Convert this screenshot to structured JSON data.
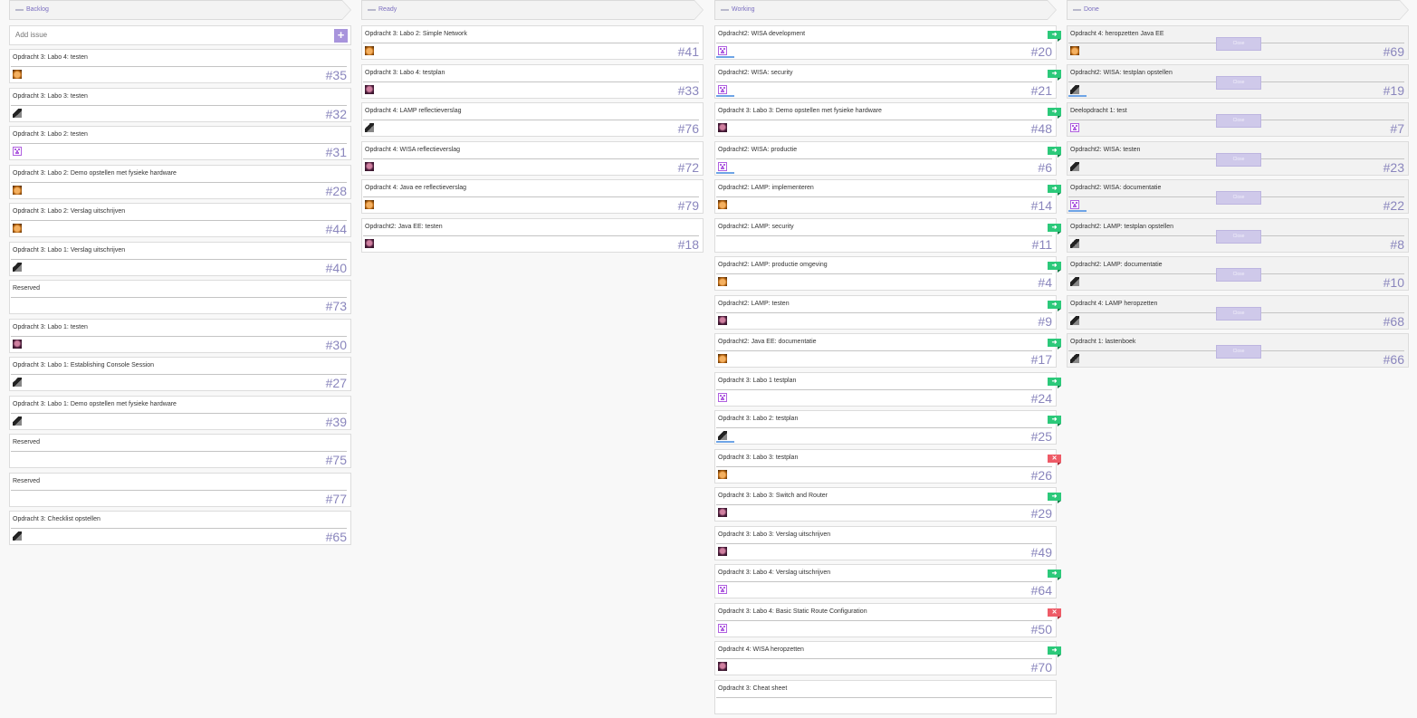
{
  "columns": [
    {
      "title": "Backlog",
      "add_placeholder": "Add issue",
      "add_label": "+",
      "cards": [
        {
          "title": "Opdracht 3: Labo 4: testen",
          "number": "#35",
          "avatar": "orange"
        },
        {
          "title": "Opdracht 3: Labo 3: testen",
          "number": "#32",
          "avatar": "dark"
        },
        {
          "title": "Opdracht 3: Labo 2: testen",
          "number": "#31",
          "avatar": "pixel"
        },
        {
          "title": "Opdracht 3: Labo 2: Demo opstellen met fysieke hardware",
          "number": "#28",
          "avatar": "orange"
        },
        {
          "title": "Opdracht 3: Labo 2: Verslag uitschrijven",
          "number": "#44",
          "avatar": "orange"
        },
        {
          "title": "Opdracht 3: Labo 1: Verslag uitschrijven",
          "number": "#40",
          "avatar": "dark"
        },
        {
          "title": "Reserved",
          "number": "#73",
          "avatar": ""
        },
        {
          "title": "Opdracht 3: Labo 1: testen",
          "number": "#30",
          "avatar": "purple"
        },
        {
          "title": "Opdracht 3: Labo 1: Establishing Console Session",
          "number": "#27",
          "avatar": "dark"
        },
        {
          "title": "Opdracht 3: Labo 1: Demo opstellen met fysieke hardware",
          "number": "#39",
          "avatar": "dark"
        },
        {
          "title": "Reserved",
          "number": "#75",
          "avatar": ""
        },
        {
          "title": "Reserved",
          "number": "#77",
          "avatar": ""
        },
        {
          "title": "Opdracht 3: Checklist opstellen",
          "number": "#65",
          "avatar": "dark"
        }
      ]
    },
    {
      "title": "Ready",
      "cards": [
        {
          "title": "Opdracht 3: Labo 2: Simple Network",
          "number": "#41",
          "avatar": "orange"
        },
        {
          "title": "Opdracht 3: Labo 4: testplan",
          "number": "#33",
          "avatar": "purple"
        },
        {
          "title": "Opdracht 4: LAMP reflectieverslag",
          "number": "#76",
          "avatar": "dark"
        },
        {
          "title": "Opdracht 4: WISA reflectieverslag",
          "number": "#72",
          "avatar": "purple"
        },
        {
          "title": "Opdracht 4: Java ee reflectieverslag",
          "number": "#79",
          "avatar": "orange"
        },
        {
          "title": "Opdracht2: Java EE: testen",
          "number": "#18",
          "avatar": "purple"
        }
      ]
    },
    {
      "title": "Working",
      "cards": [
        {
          "title": "Opdracht2: WISA development",
          "number": "#20",
          "avatar": "pixel",
          "flag": "ok",
          "flag_label": "➜",
          "progress": 0.5
        },
        {
          "title": "Opdracht2: WISA: security",
          "number": "#21",
          "avatar": "pixel",
          "flag": "ok",
          "flag_label": "➜",
          "progress": 0.5
        },
        {
          "title": "Opdracht 3: Labo 3: Demo opstellen met fysieke hardware",
          "number": "#48",
          "avatar": "purple",
          "flag": "ok",
          "flag_label": "➜"
        },
        {
          "title": "Opdracht2: WISA: productie",
          "number": "#6",
          "avatar": "pixel",
          "flag": "ok",
          "flag_label": "➜",
          "progress": 0.5
        },
        {
          "title": "Opdracht2: LAMP: implementeren",
          "number": "#14",
          "avatar": "orange",
          "flag": "ok",
          "flag_label": "➜"
        },
        {
          "title": "Opdracht2: LAMP: security",
          "number": "#11",
          "avatar": "",
          "flag": "ok",
          "flag_label": "➜"
        },
        {
          "title": "Opdracht2: LAMP: productie omgeving",
          "number": "#4",
          "avatar": "orange",
          "flag": "ok",
          "flag_label": "➜"
        },
        {
          "title": "Opdracht2: LAMP: testen",
          "number": "#9",
          "avatar": "purple",
          "flag": "ok",
          "flag_label": "➜"
        },
        {
          "title": "Opdracht2: Java EE: documentatie",
          "number": "#17",
          "avatar": "orange",
          "flag": "ok",
          "flag_label": "➜"
        },
        {
          "title": "Opdracht 3: Labo 1 testplan",
          "number": "#24",
          "avatar": "pixel",
          "flag": "ok",
          "flag_label": "➜"
        },
        {
          "title": "Opdracht 3: Labo 2: testplan",
          "number": "#25",
          "avatar": "dark",
          "flag": "ok",
          "flag_label": "➜",
          "progress": 0.5
        },
        {
          "title": "Opdracht 3: Labo 3: testplan",
          "number": "#26",
          "avatar": "orange",
          "flag": "bad",
          "flag_label": "✕"
        },
        {
          "title": "Opdracht 3: Labo 3: Switch and Router",
          "number": "#29",
          "avatar": "purple",
          "flag": "ok",
          "flag_label": "➜"
        },
        {
          "title": "Opdracht 3: Labo 3: Verslag uitschrijven",
          "number": "#49",
          "avatar": "purple"
        },
        {
          "title": "Opdracht 3: Labo 4: Verslag uitschrijven",
          "number": "#64",
          "avatar": "pixel",
          "flag": "ok",
          "flag_label": "➜"
        },
        {
          "title": "Opdracht 3: Labo 4: Basic Static Route Configuration",
          "number": "#50",
          "avatar": "pixel",
          "flag": "bad",
          "flag_label": "✕"
        },
        {
          "title": "Opdracht 4: WISA heropzetten",
          "number": "#70",
          "avatar": "purple",
          "flag": "ok",
          "flag_label": "➜"
        },
        {
          "title": "Opdracht 3: Cheat sheet",
          "number": "",
          "avatar": ""
        }
      ]
    },
    {
      "title": "Done",
      "close_label": "Close",
      "cards": [
        {
          "title": "Opdracht 4: heropzetten Java EE",
          "number": "#69",
          "avatar": "orange"
        },
        {
          "title": "Opdracht2: WISA: testplan opstellen",
          "number": "#19",
          "avatar": "dark",
          "progress": 0.5
        },
        {
          "title": "Deelopdracht 1: test",
          "number": "#7",
          "avatar": "pixel"
        },
        {
          "title": "Opdracht2: WISA: testen",
          "number": "#23",
          "avatar": "dark"
        },
        {
          "title": "Opdracht2: WISA: documentatie",
          "number": "#22",
          "avatar": "pixel",
          "progress": 0.5
        },
        {
          "title": "Opdracht2: LAMP: testplan opstellen",
          "number": "#8",
          "avatar": "dark"
        },
        {
          "title": "Opdracht2: LAMP: documentatie",
          "number": "#10",
          "avatar": "dark"
        },
        {
          "title": "Opdracht 4: LAMP heropzetten",
          "number": "#68",
          "avatar": "dark"
        },
        {
          "title": "Opdracht 1: lastenboek",
          "number": "#66",
          "avatar": "dark"
        }
      ]
    }
  ]
}
